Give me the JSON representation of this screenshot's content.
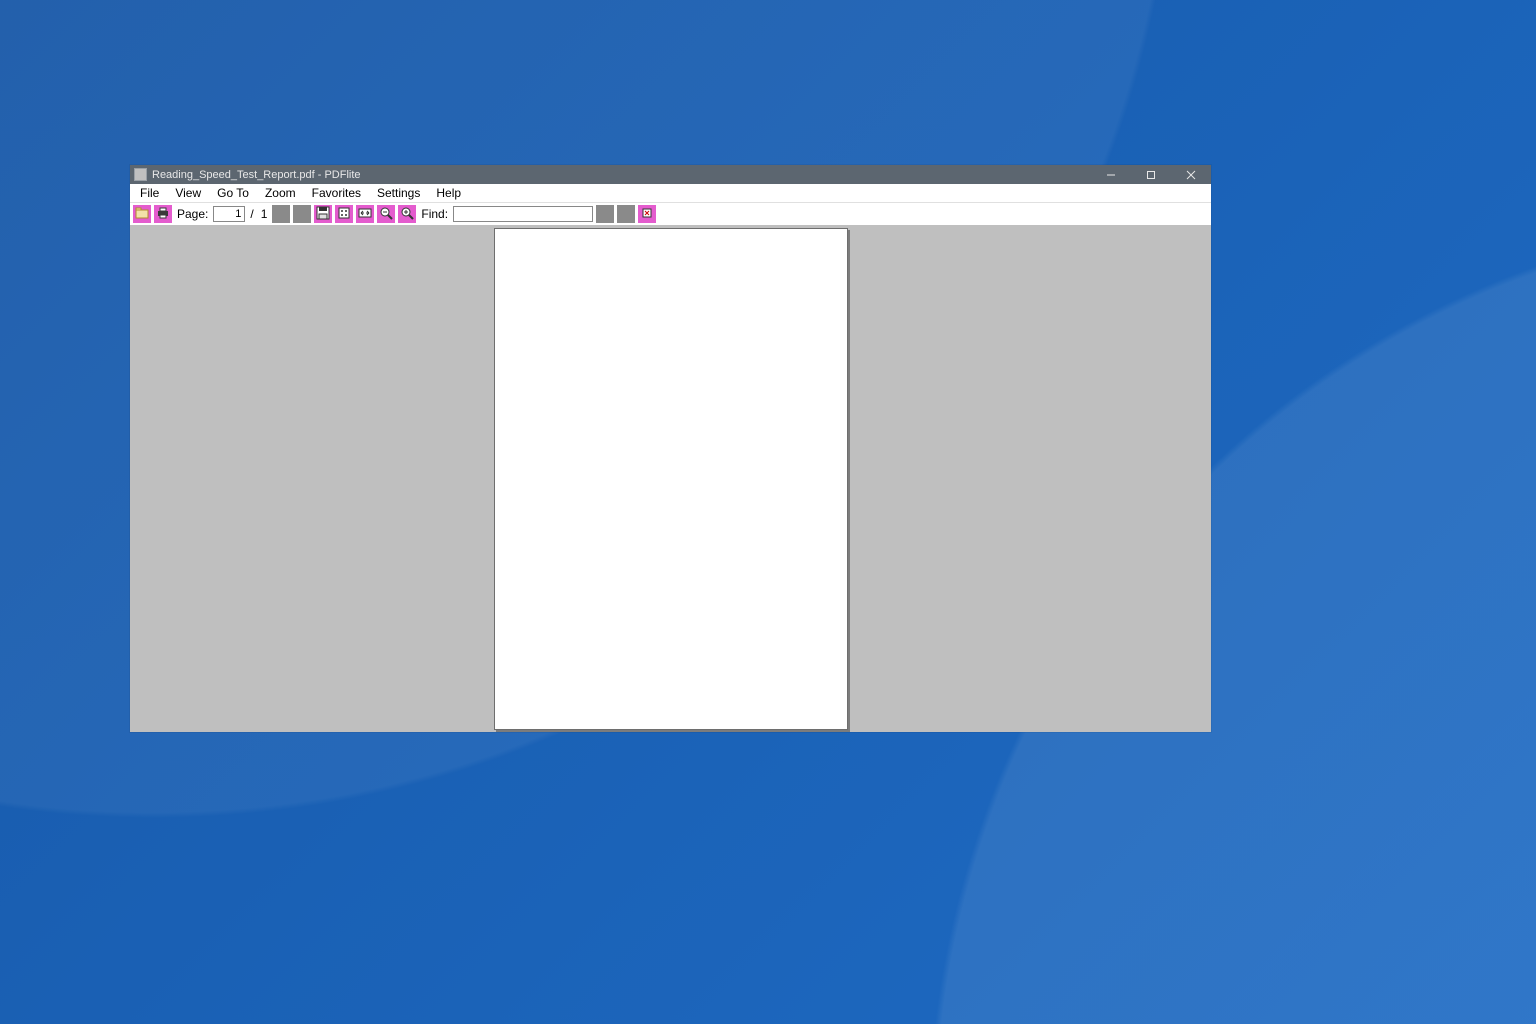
{
  "window": {
    "title": "Reading_Speed_Test_Report.pdf - PDFlite"
  },
  "menu": {
    "file": "File",
    "view": "View",
    "goto": "Go To",
    "zoom": "Zoom",
    "favorites": "Favorites",
    "settings": "Settings",
    "help": "Help"
  },
  "toolbar": {
    "page_label": "Page:",
    "page_current": "1",
    "page_sep": "/",
    "page_total": "1",
    "find_label": "Find:",
    "find_value": ""
  },
  "icons": {
    "open": "open-icon",
    "print": "print-icon",
    "prev": "prev-page-icon",
    "next": "next-page-icon",
    "save": "save-icon",
    "fitpage": "fit-page-icon",
    "fitwidth": "fit-width-icon",
    "zoomout": "zoom-out-icon",
    "zoomin": "zoom-in-icon",
    "findprev": "find-prev-icon",
    "findnext": "find-next-icon",
    "findclose": "find-close-icon"
  }
}
